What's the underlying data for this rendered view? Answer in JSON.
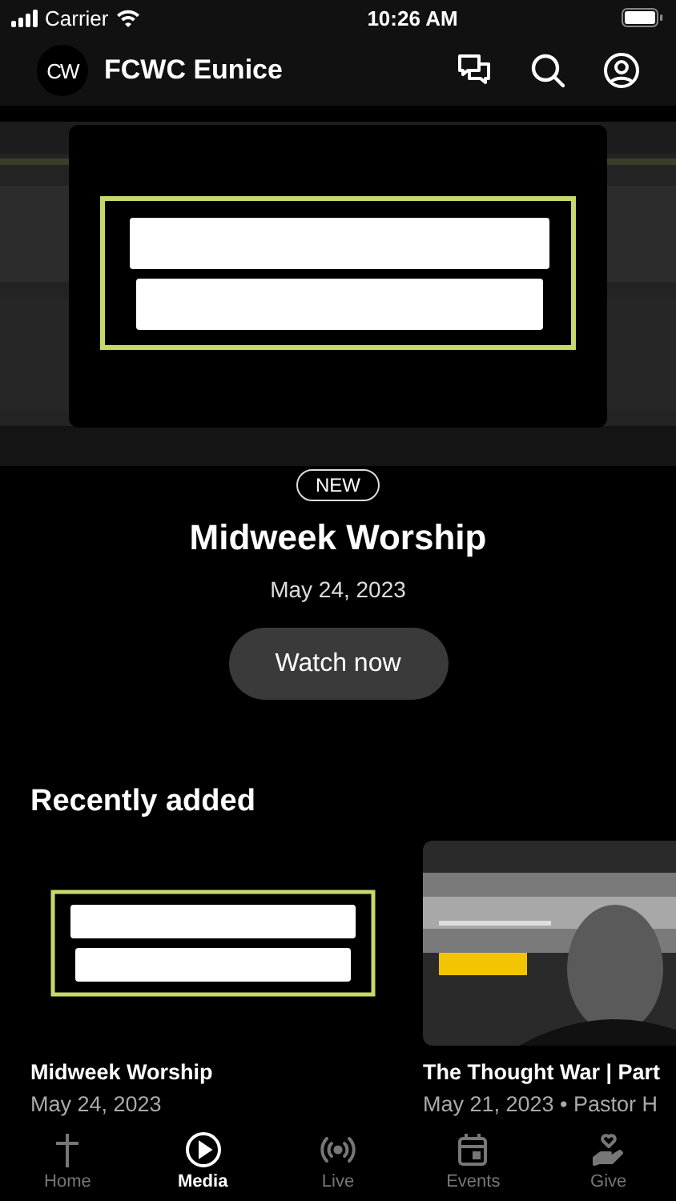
{
  "status_bar": {
    "carrier": "Carrier",
    "time": "10:26 AM"
  },
  "header": {
    "logo": "CW",
    "title": "FCWC Eunice"
  },
  "featured": {
    "badge": "NEW",
    "title": "Midweek Worship",
    "date": "May 24, 2023",
    "button": "Watch now"
  },
  "recently_added": {
    "heading": "Recently added",
    "items": [
      {
        "kind": "midweek",
        "title": "Midweek Worship",
        "subtitle": "May 24, 2023"
      },
      {
        "kind": "portrait",
        "title": "The Thought War | Part",
        "subtitle": "May 21, 2023 • Pastor H"
      }
    ]
  },
  "tabs": [
    {
      "kind": "home",
      "label": "Home",
      "selected": false
    },
    {
      "kind": "media",
      "label": "Media",
      "selected": true
    },
    {
      "kind": "live",
      "label": "Live",
      "selected": false
    },
    {
      "kind": "events",
      "label": "Events",
      "selected": false
    },
    {
      "kind": "give",
      "label": "Give",
      "selected": false
    }
  ]
}
